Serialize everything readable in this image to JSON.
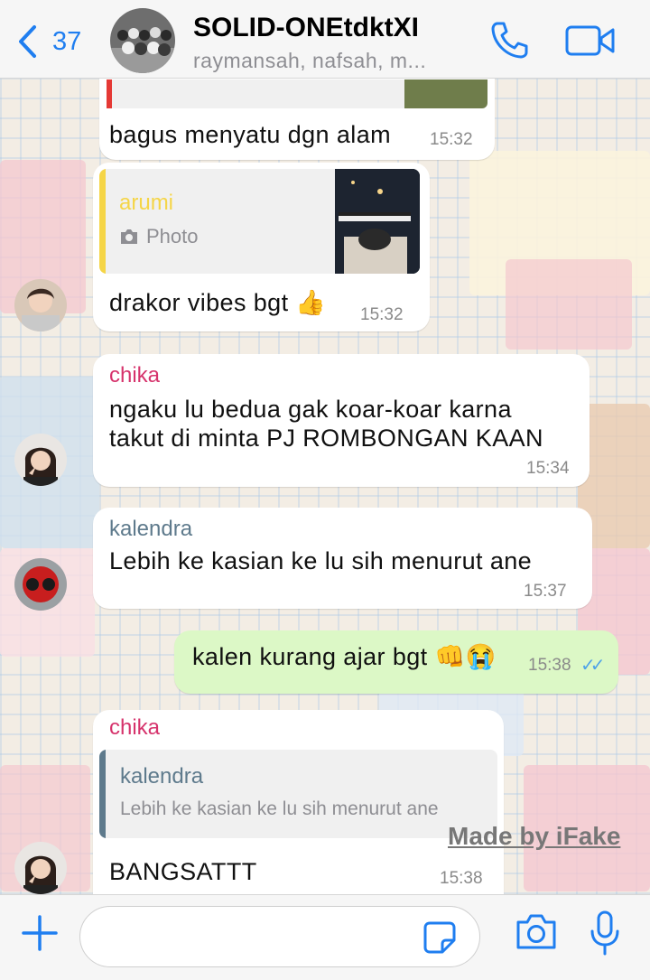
{
  "header": {
    "back_count": "37",
    "group_name": "SOLID-ONEtdktXI",
    "members": "raymansah, nafsah, m..."
  },
  "messages": [
    {
      "text": "bagus menyatu dgn alam",
      "time": "15:32"
    },
    {
      "quote_sender": "arumi",
      "quote_text": "Photo",
      "text": "drakor vibes bgt 👍",
      "time": "15:32"
    },
    {
      "sender": "chika",
      "line1": "ngaku lu bedua gak koar-koar karna",
      "line2": "takut di minta PJ ROMBONGAN KAAN",
      "time": "15:34"
    },
    {
      "sender": "kalendra",
      "text": "Lebih ke kasian ke lu sih menurut ane",
      "time": "15:37"
    },
    {
      "text": "kalen kurang ajar bgt 👊😭",
      "time": "15:38",
      "ticks": "✓✓"
    },
    {
      "sender": "chika",
      "quote_sender": "kalendra",
      "quote_text": "Lebih ke kasian ke lu sih menurut ane",
      "text": "BANGSATTT",
      "time": "15:38"
    }
  ],
  "watermark": "Made by iFake",
  "colors": {
    "accent": "#1f7ef0",
    "chika": "#d6336c",
    "kalendra": "#5e7a8c",
    "arumi": "#f5d547",
    "outgoing_bubble": "#dcf8c6",
    "read_ticks": "#4fa3e8"
  }
}
